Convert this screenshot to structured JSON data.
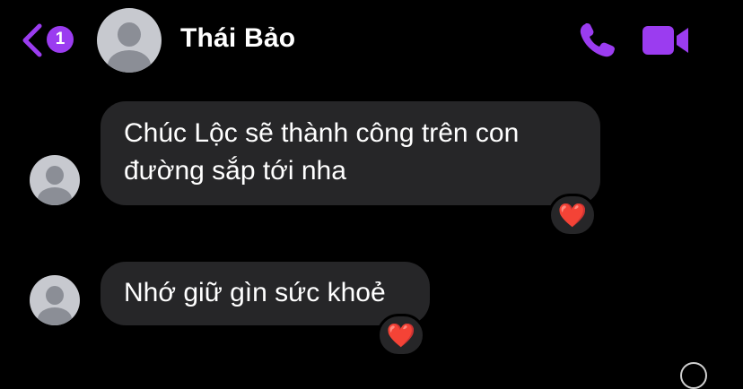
{
  "header": {
    "back_icon": "chevron-left-icon",
    "unread_count": "1",
    "contact_name": "Thái Bảo",
    "call_icon": "phone-icon",
    "video_icon": "video-camera-icon",
    "accent_color": "#9b3cf0"
  },
  "messages": [
    {
      "text_lines": [
        "Chúc Lộc sẽ thành công trên con",
        "đường sắp tới nha"
      ],
      "reaction": "❤️"
    },
    {
      "text_lines": [
        "Nhớ giữ gìn sức khoẻ"
      ],
      "reaction": "❤️"
    }
  ],
  "colors": {
    "bubble": "#262628",
    "background": "#000000",
    "reaction_heart": "#e8102f"
  }
}
